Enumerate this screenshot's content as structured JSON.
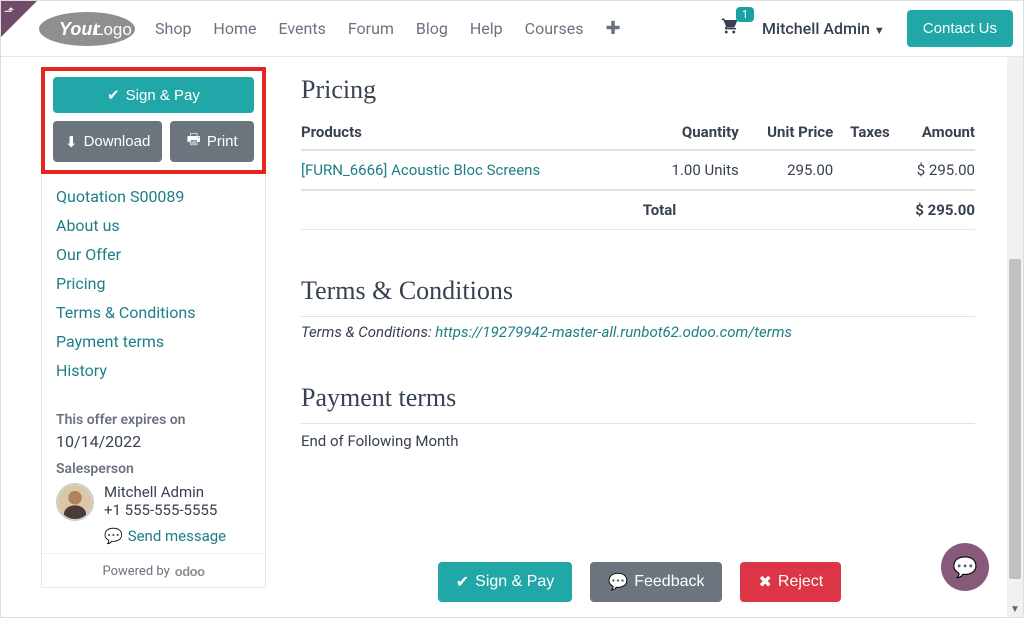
{
  "header": {
    "nav": [
      "Shop",
      "Home",
      "Events",
      "Forum",
      "Blog",
      "Help",
      "Courses"
    ],
    "cart_count": "1",
    "user_name": "Mitchell Admin",
    "contact_label": "Contact Us"
  },
  "sidebar": {
    "sign_pay": "Sign & Pay",
    "download": "Download",
    "print": "Print",
    "links": [
      "Quotation S00089",
      "About us",
      "Our Offer",
      "Pricing",
      "Terms & Conditions",
      "Payment terms",
      "History"
    ],
    "expires_label": "This offer expires on",
    "expires_value": "10/14/2022",
    "salesperson_label": "Salesperson",
    "salesperson_name": "Mitchell Admin",
    "salesperson_phone": "+1 555-555-5555",
    "send_message": "Send message",
    "powered_by": "Powered by"
  },
  "main": {
    "pricing_heading": "Pricing",
    "cols": {
      "products": "Products",
      "quantity": "Quantity",
      "unit_price": "Unit Price",
      "taxes": "Taxes",
      "amount": "Amount"
    },
    "line": {
      "name": "[FURN_6666] Acoustic Bloc Screens",
      "qty": "1.00 Units",
      "unit_price": "295.00",
      "taxes": "",
      "amount": "$ 295.00"
    },
    "total_label": "Total",
    "total_amount": "$ 295.00",
    "terms_heading": "Terms & Conditions",
    "terms_prefix": "Terms & Conditions: ",
    "terms_url": "https://19279942-master-all.runbot62.odoo.com/terms",
    "payment_terms_heading": "Payment terms",
    "payment_terms_value": "End of Following Month"
  },
  "footer": {
    "sign_pay": "Sign & Pay",
    "feedback": "Feedback",
    "reject": "Reject"
  }
}
